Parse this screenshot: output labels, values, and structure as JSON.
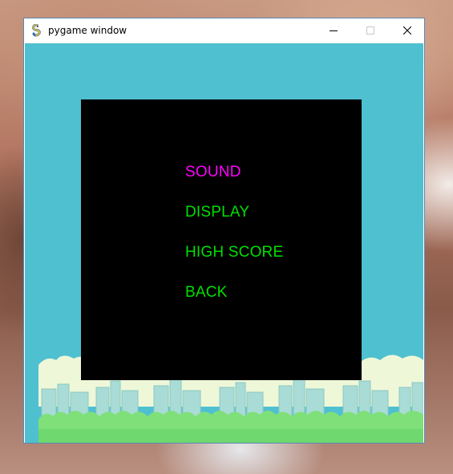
{
  "window": {
    "title": "pygame window",
    "icon": "pygame-snake-icon",
    "controls": [
      "minimize-icon",
      "maximize-icon",
      "close-icon"
    ]
  },
  "menu": {
    "items": [
      {
        "label": "SOUND",
        "selected": true
      },
      {
        "label": "DISPLAY",
        "selected": false
      },
      {
        "label": "HIGH SCORE",
        "selected": false
      },
      {
        "label": "BACK",
        "selected": false
      }
    ]
  },
  "colors": {
    "sky": "#4fc0d0",
    "panel": "#000000",
    "selected_item": "#ff00ff",
    "item": "#00e000",
    "ground_green": "#6fde6f",
    "city": "#9ad6d0",
    "cloud": "#eef7d8"
  }
}
